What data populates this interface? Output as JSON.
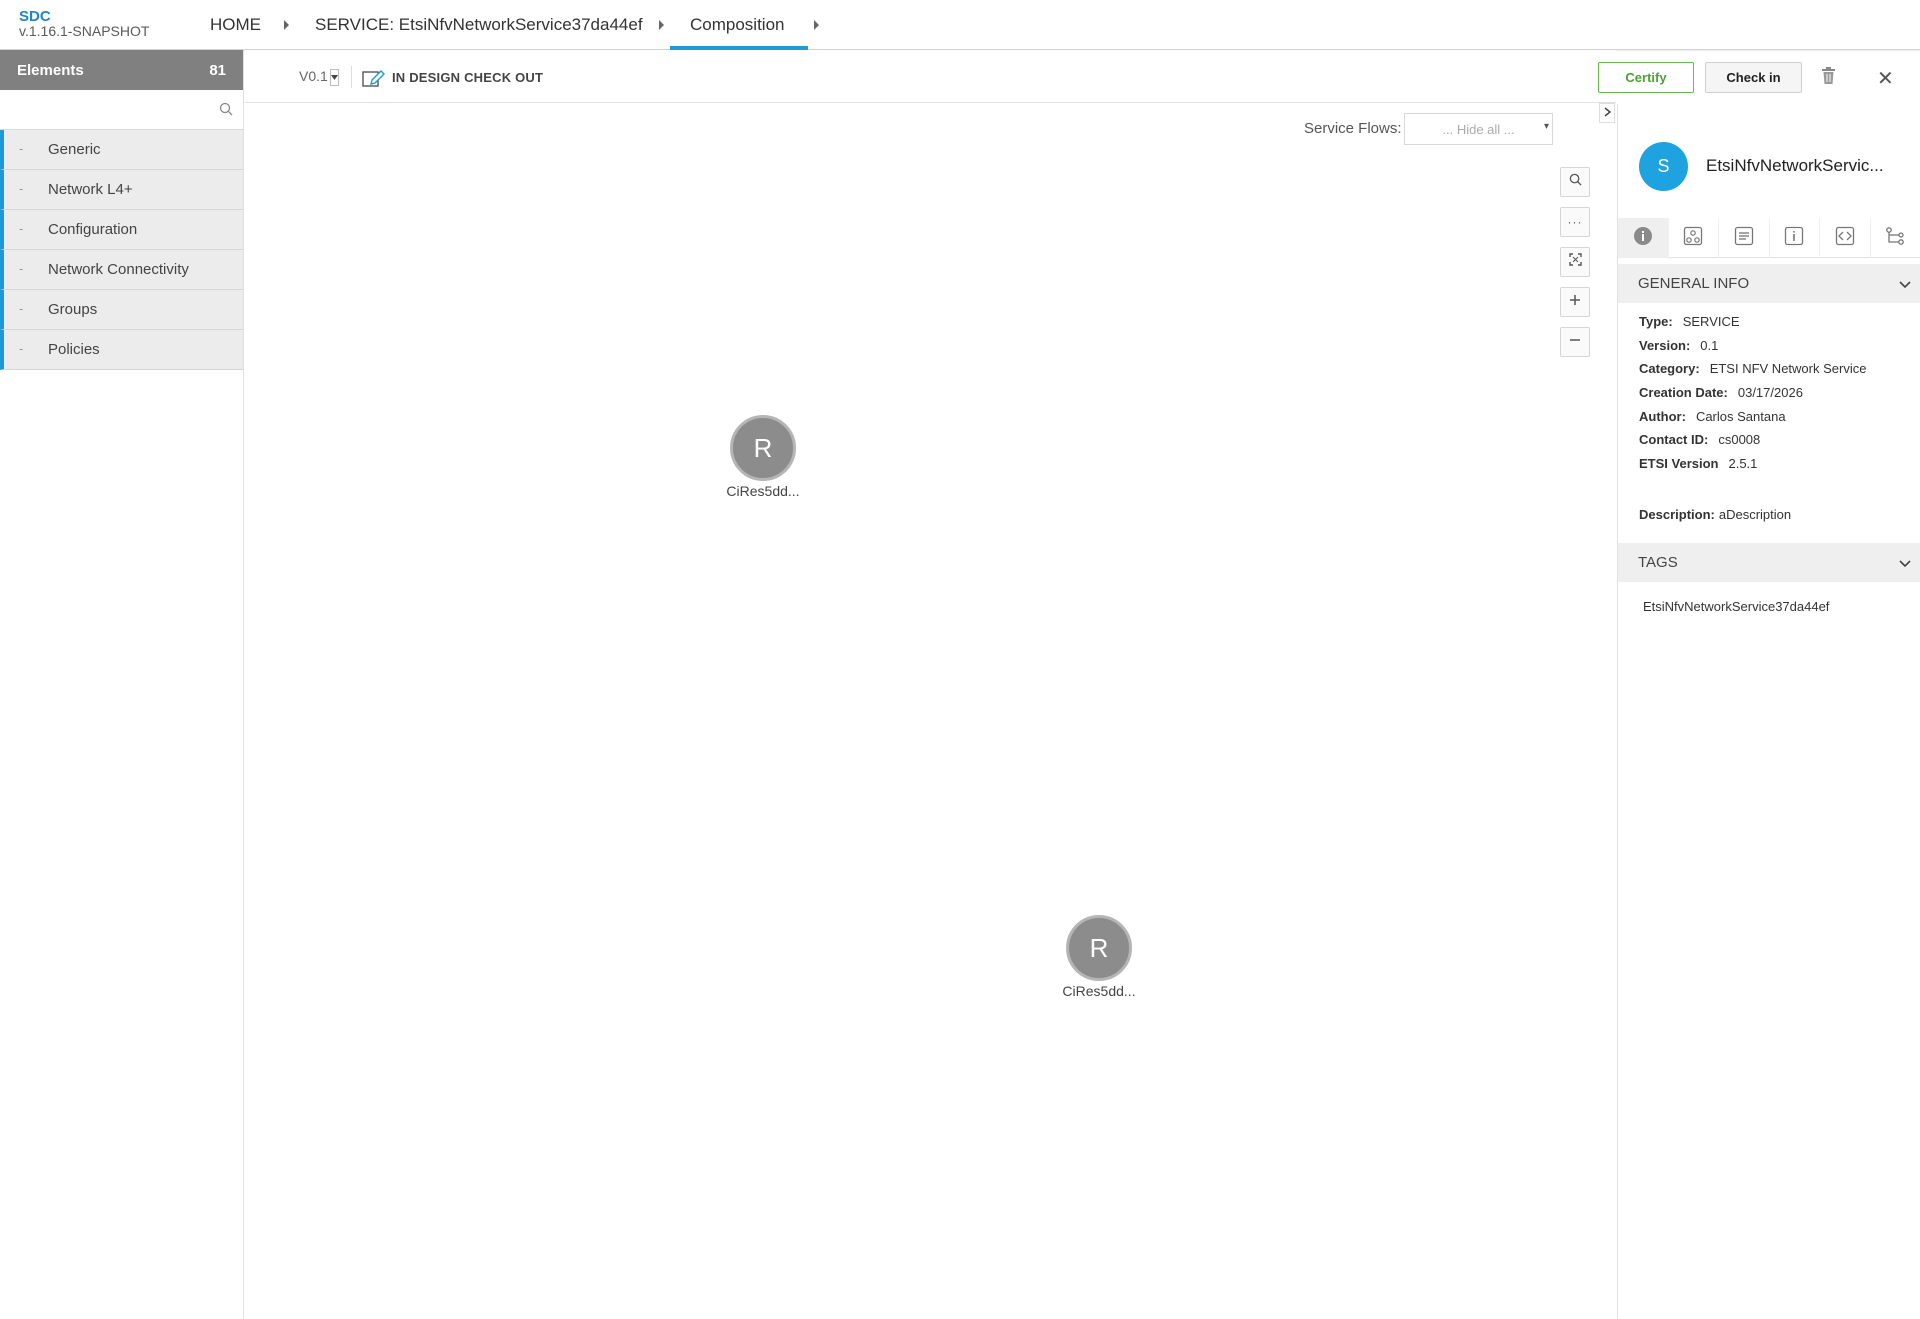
{
  "app": {
    "name": "SDC",
    "version": "v.1.16.1-SNAPSHOT"
  },
  "breadcrumb": {
    "home": "HOME",
    "service": "SERVICE: EtsiNfvNetworkService37da44ef",
    "current": "Composition"
  },
  "palette": {
    "title": "Elements",
    "count": "81",
    "search_placeholder": "",
    "categories": [
      {
        "dash": "-",
        "label": "Generic"
      },
      {
        "dash": "-",
        "label": "Network L4+"
      },
      {
        "dash": "-",
        "label": "Configuration"
      },
      {
        "dash": "-",
        "label": "Network Connectivity"
      },
      {
        "dash": "-",
        "label": "Groups"
      },
      {
        "dash": "-",
        "label": "Policies"
      }
    ]
  },
  "toolbar": {
    "version": "V0.1",
    "status": "IN DESIGN CHECK OUT",
    "certify_label": "Certify",
    "checkin_label": "Check in",
    "close_glyph": "✕"
  },
  "canvas": {
    "service_flows_label": "Service Flows:",
    "service_flows_value": "... Hide all ...",
    "zoom_controls": [
      "search-icon",
      "more-icon",
      "fit-icon",
      "plus-icon",
      "minus-icon"
    ],
    "nodes": [
      {
        "letter": "R",
        "label": "CiRes5dd..."
      },
      {
        "letter": "R",
        "label": "CiRes5dd..."
      }
    ]
  },
  "right_panel": {
    "avatar_letter": "S",
    "title": "EtsiNfvNetworkServic...",
    "tabs": [
      "info-icon",
      "composition-icon",
      "artifacts-icon",
      "details-icon",
      "api-icon",
      "paths-icon"
    ],
    "general_info": {
      "heading": "GENERAL INFO",
      "rows": [
        {
          "key": "Type:",
          "value": "SERVICE"
        },
        {
          "key": "Version:",
          "value": "0.1"
        },
        {
          "key": "Category:",
          "value": "ETSI NFV Network Service"
        },
        {
          "key": "Creation Date:",
          "value": "03/17/2026"
        },
        {
          "key": "Author:",
          "value": "Carlos Santana"
        },
        {
          "key": "Contact ID:",
          "value": "cs0008"
        },
        {
          "key": "ETSI Version",
          "value": "2.5.1"
        }
      ],
      "description_key": "Description:",
      "description_value": "aDescription"
    },
    "tags": {
      "heading": "TAGS",
      "items": [
        "EtsiNfvNetworkService37da44ef"
      ]
    }
  },
  "colors": {
    "accent": "#1e9bd7",
    "certify": "#4aa234",
    "palette_header": "#808080",
    "node": "#8c8c8c",
    "avatar": "#1fa3e0"
  }
}
